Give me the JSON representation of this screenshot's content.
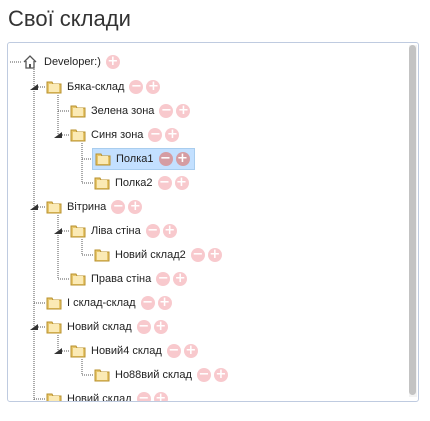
{
  "page": {
    "title": "Свої склади"
  },
  "tree": {
    "root_label": "Developer:)",
    "nodes": [
      {
        "label": "Бяка-склад"
      },
      {
        "label": "Зелена зона"
      },
      {
        "label": "Синя зона"
      },
      {
        "label": "Полка1",
        "selected": true
      },
      {
        "label": "Полка2"
      },
      {
        "label": "Вітрина"
      },
      {
        "label": "Ліва стіна"
      },
      {
        "label": "Новий склад2"
      },
      {
        "label": "Права стіна"
      },
      {
        "label": "І склад-склад"
      },
      {
        "label": "Новий склад"
      },
      {
        "label": "Новий4 склад"
      },
      {
        "label": "Но88вий склад"
      },
      {
        "label": "Новий склад"
      }
    ],
    "add_symbol": "+",
    "remove_symbol": "−",
    "colors": {
      "button": "#f8c9cd",
      "selected_bg": "#c3e0ff",
      "folder": "#e7c66a"
    }
  }
}
